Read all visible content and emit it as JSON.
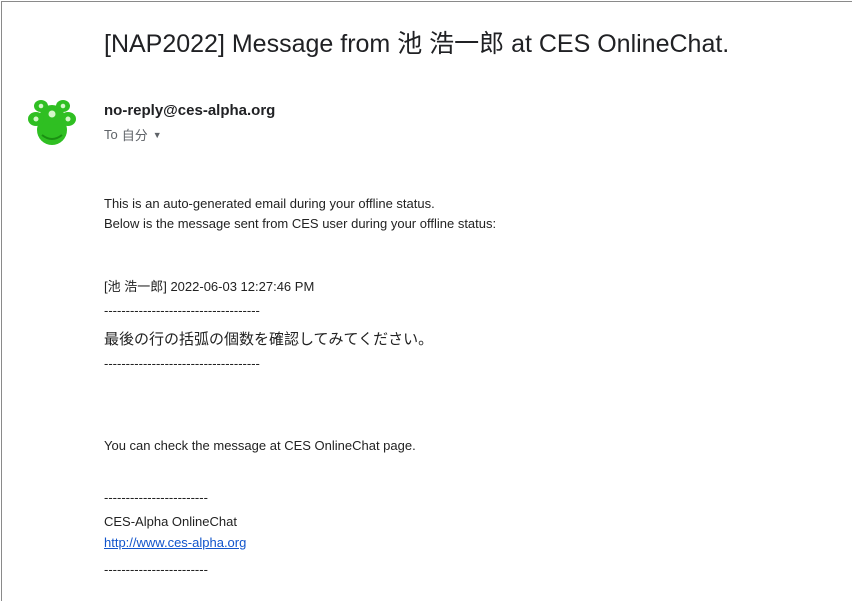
{
  "email": {
    "subject": "[NAP2022] Message from 池 浩一郎 at CES OnlineChat.",
    "sender_email": "no-reply@ces-alpha.org",
    "to_label": "To",
    "recipient": "自分",
    "avatar_icon": "green-paw-avatar",
    "body": {
      "line1": "This is an auto-generated email during your offline status.",
      "line2": "Below is the message sent from CES user during your offline status:",
      "message_header": "[池 浩一郎] 2022-06-03 12:27:46 PM",
      "separator_long": "------------------------------------",
      "message_text": "最後の行の括弧の個数を確認してみてください。",
      "check_line": "You can check the message at CES OnlineChat page.",
      "separator_short": "------------------------",
      "signature_name": "CES-Alpha OnlineChat",
      "signature_link": "http://www.ces-alpha.org"
    }
  },
  "colors": {
    "avatar_green": "#2fbf22",
    "avatar_dark": "#1a8f12",
    "link": "#1155cc"
  }
}
